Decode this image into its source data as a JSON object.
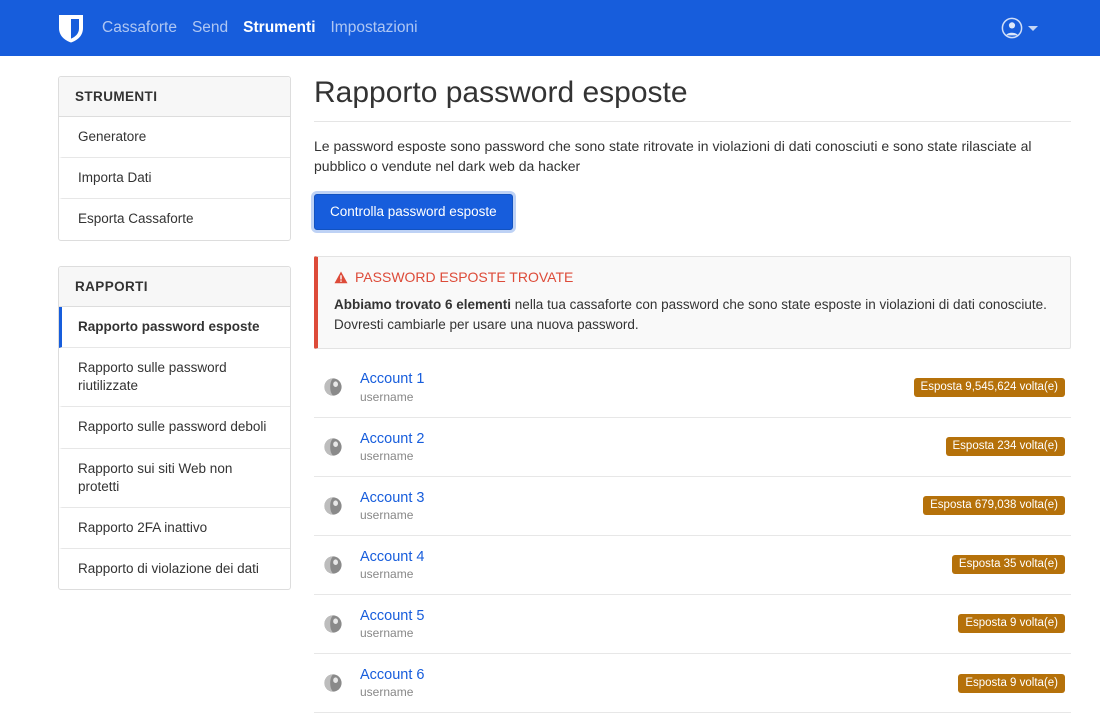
{
  "navbar": {
    "logo_icon": "shield-logo-icon",
    "links": [
      {
        "label": "Cassaforte",
        "active": false
      },
      {
        "label": "Send",
        "active": false
      },
      {
        "label": "Strumenti",
        "active": true
      },
      {
        "label": "Impostazioni",
        "active": false
      }
    ],
    "account_icon": "user-circle-icon",
    "caret_icon": "chevron-down-icon"
  },
  "sidebar": {
    "tools": {
      "header": "STRUMENTI",
      "items": [
        {
          "label": "Generatore"
        },
        {
          "label": "Importa Dati"
        },
        {
          "label": "Esporta Cassaforte"
        }
      ]
    },
    "reports": {
      "header": "RAPPORTI",
      "items": [
        {
          "label": "Rapporto password esposte"
        },
        {
          "label": "Rapporto sulle password riutilizzate"
        },
        {
          "label": "Rapporto sulle password deboli"
        },
        {
          "label": "Rapporto sui siti Web non protetti"
        },
        {
          "label": "Rapporto 2FA inattivo"
        },
        {
          "label": "Rapporto di violazione dei dati"
        }
      ]
    }
  },
  "main": {
    "title": "Rapporto password esposte",
    "description": "Le password esposte sono password che sono state ritrovate in violazioni di dati conosciuti e sono state rilasciate al pubblico o vendute nel dark web da hacker",
    "check_button": "Controlla password esposte",
    "alert": {
      "icon": "warning-triangle-icon",
      "title": "PASSWORD ESPOSTE TROVATE",
      "body_lead": "Abbiamo trovato 6 elementi",
      "body_rest": " nella tua cassaforte con password che sono state esposte in violazioni di dati conosciute. Dovresti cambiarle per usare una nuova password."
    },
    "items": [
      {
        "icon": "globe-icon",
        "name": "Account 1",
        "username": "username",
        "badge": "Esposta 9,545,624 volta(e)"
      },
      {
        "icon": "globe-icon",
        "name": "Account 2",
        "username": "username",
        "badge": "Esposta 234 volta(e)"
      },
      {
        "icon": "globe-icon",
        "name": "Account 3",
        "username": "username",
        "badge": "Esposta 679,038 volta(e)"
      },
      {
        "icon": "globe-icon",
        "name": "Account 4",
        "username": "username",
        "badge": "Esposta 35 volta(e)"
      },
      {
        "icon": "globe-icon",
        "name": "Account 5",
        "username": "username",
        "badge": "Esposta 9 volta(e)"
      },
      {
        "icon": "globe-icon",
        "name": "Account 6",
        "username": "username",
        "badge": "Esposta 9 volta(e)"
      }
    ]
  },
  "colors": {
    "brand_blue": "#175ddc",
    "alert_red": "#dd4b39",
    "badge_amber": "#b5710a",
    "link_blue": "#175ddc"
  }
}
